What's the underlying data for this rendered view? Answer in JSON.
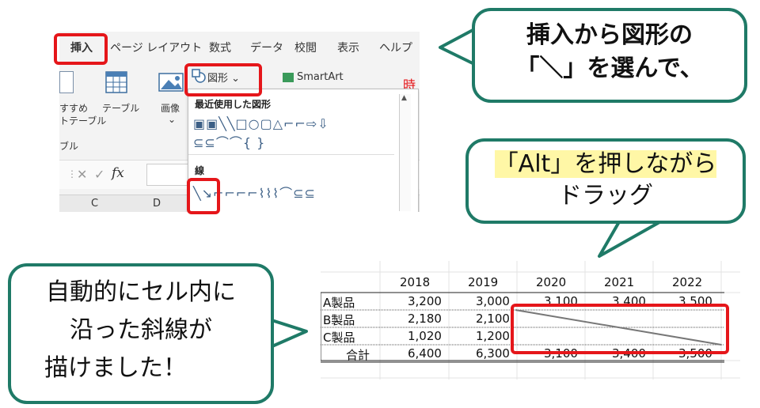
{
  "ribbon": {
    "tabs": [
      "挿入",
      "ページ レイアウト",
      "数式",
      "データ",
      "校閲",
      "表示",
      "ヘルプ"
    ],
    "labels": {
      "recommended_line1": "すすめ",
      "recommended_line2": "トテーブル",
      "table": "テーブル",
      "image": "画像",
      "image_caret": "⌄",
      "group_table": "ブル"
    },
    "shapes_button": "図形 ⌄",
    "smartart_button": "SmartArt",
    "formula": {
      "name_dots": "⋮",
      "cancel": "✕",
      "enter": "✓",
      "fx": "fx"
    },
    "columns": [
      "C",
      "D"
    ],
    "cutoff_char": "時"
  },
  "dropdown": {
    "recent_heading": "最近使用した図形",
    "recent_row1": "▣▣╲╲□○▢△⌐⌐⇨⇩",
    "recent_row2": "⊆⊆⌒⌒{ }",
    "lines_heading": "線",
    "lines_row": "╲↘⌐⌐⌐⌐⌇⌇⌇⌒⊆⊆"
  },
  "callouts": {
    "top_right": {
      "line1": "挿入から図形の",
      "line2": "「＼」を選んで、"
    },
    "middle_right": {
      "line1": "「Alt」を押しながら",
      "line2": "ドラッグ"
    },
    "left": {
      "line1": "自動的にセル内に",
      "line2": "沿った斜線が",
      "line3": "描けました！"
    }
  },
  "table": {
    "years": [
      "2018",
      "2019",
      "2020",
      "2021",
      "2022"
    ],
    "rows": [
      {
        "label": "A製品",
        "values": [
          "3,200",
          "3,000",
          "3,100",
          "3,400",
          "3,500"
        ]
      },
      {
        "label": "B製品",
        "values": [
          "2,180",
          "2,100",
          "",
          "",
          ""
        ]
      },
      {
        "label": "C製品",
        "values": [
          "1,020",
          "1,200",
          "",
          "",
          ""
        ]
      },
      {
        "label": "合計",
        "values": [
          "6,400",
          "6,300",
          "3,100",
          "3,400",
          "3,500"
        ]
      }
    ]
  },
  "colors": {
    "highlight_red": "#e5161a",
    "callout_border": "#1f7a67",
    "text_highlight": "#fff7a6"
  }
}
